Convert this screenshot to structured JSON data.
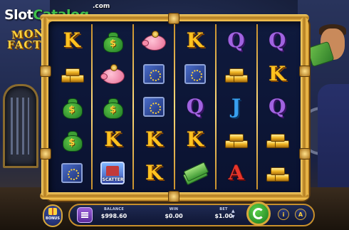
{
  "watermark": {
    "brand_prefix": "Slot",
    "brand_suffix": "Catalog",
    "domain": ".com"
  },
  "game_logo": {
    "line1": "MONEY",
    "line2": "FACTORY"
  },
  "reels": [
    [
      {
        "sym": "K",
        "kind": "letter"
      },
      {
        "sym": "goldbars",
        "kind": "icon"
      },
      {
        "sym": "moneybag",
        "kind": "icon"
      },
      {
        "sym": "moneybag",
        "kind": "icon"
      },
      {
        "sym": "safe",
        "kind": "icon"
      }
    ],
    [
      {
        "sym": "moneybag",
        "kind": "icon"
      },
      {
        "sym": "piggy",
        "kind": "icon"
      },
      {
        "sym": "moneybag",
        "kind": "icon"
      },
      {
        "sym": "K",
        "kind": "letter"
      },
      {
        "sym": "scatter",
        "kind": "icon"
      }
    ],
    [
      {
        "sym": "piggy",
        "kind": "icon"
      },
      {
        "sym": "safe",
        "kind": "icon"
      },
      {
        "sym": "safe",
        "kind": "icon"
      },
      {
        "sym": "K",
        "kind": "letter"
      },
      {
        "sym": "K",
        "kind": "letter"
      }
    ],
    [
      {
        "sym": "K",
        "kind": "letter"
      },
      {
        "sym": "safe",
        "kind": "icon"
      },
      {
        "sym": "Q",
        "kind": "letter"
      },
      {
        "sym": "K",
        "kind": "letter"
      },
      {
        "sym": "cash",
        "kind": "icon"
      }
    ],
    [
      {
        "sym": "Q",
        "kind": "letter"
      },
      {
        "sym": "goldbars",
        "kind": "icon"
      },
      {
        "sym": "J",
        "kind": "letter"
      },
      {
        "sym": "goldbars",
        "kind": "icon"
      },
      {
        "sym": "A",
        "kind": "letter"
      }
    ],
    [
      {
        "sym": "Q",
        "kind": "letter"
      },
      {
        "sym": "K",
        "kind": "letter"
      },
      {
        "sym": "Q",
        "kind": "letter"
      },
      {
        "sym": "goldbars",
        "kind": "icon"
      },
      {
        "sym": "goldbars",
        "kind": "icon"
      }
    ]
  ],
  "scatter_label": "SCATTER",
  "controls": {
    "bonus_label": "BONUS",
    "menu_icon": "hamburger-menu-icon",
    "balance_label": "BALANCE",
    "balance_value": "$998.60",
    "win_label": "WIN",
    "win_value": "$0.00",
    "bet_label": "BET",
    "bet_value": "$1.00",
    "spin_icon": "spin-arrow-icon",
    "autoplay_icon": "info-icon",
    "turbo_icon": "turbo-icon",
    "info_glyph": "i",
    "autoplay_glyph": "A"
  },
  "colors": {
    "frame_gold": "#c8902c",
    "spin_green": "#3cae34",
    "menu_purple": "#7a45b8"
  }
}
